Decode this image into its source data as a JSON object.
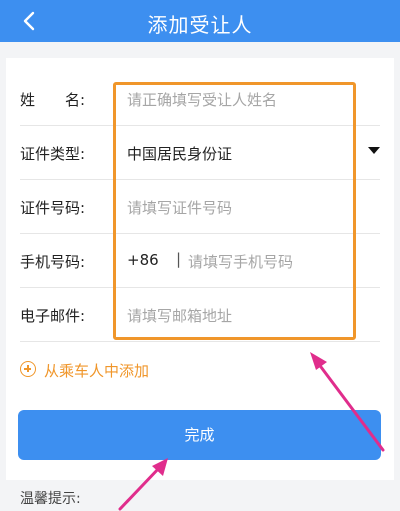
{
  "header": {
    "title": "添加受让人",
    "back_icon": "chevron-left-icon",
    "color": "#3d8ff0"
  },
  "form": {
    "name": {
      "label": "姓　　名:",
      "placeholder": "请正确填写受让人姓名"
    },
    "id_type": {
      "label": "证件类型:",
      "value": "中国居民身份证",
      "dropdown_icon": "caret-down-icon"
    },
    "id_number": {
      "label": "证件号码:",
      "placeholder": "请填写证件号码"
    },
    "phone": {
      "label": "手机号码:",
      "prefix": "+86",
      "separator": "|",
      "placeholder": "请填写手机号码"
    },
    "email": {
      "label": "电子邮件:",
      "placeholder": "请填写邮箱地址"
    }
  },
  "add_from_passenger": {
    "label": "从乘车人中添加",
    "icon": "plus-circle-icon",
    "color": "#f0962a"
  },
  "done_button": {
    "label": "完成",
    "color": "#3d8ff0"
  },
  "tip": {
    "label": "温馨提示:"
  },
  "annotation": {
    "highlight_color": "#f0962a",
    "arrow_color": "#e02d8c"
  }
}
